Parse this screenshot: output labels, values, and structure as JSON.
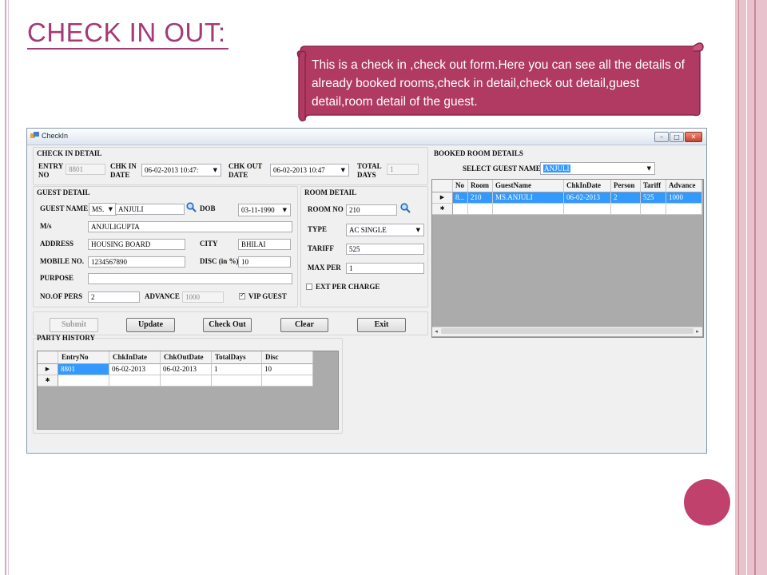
{
  "slide": {
    "title": "CHECK IN OUT",
    "title_colon": ":",
    "callout": "This  is a check in ,check out form.Here you can see all the details of already booked rooms,check in detail,check out detail,guest detail,room detail of the guest.",
    "accent_color": "#a23b77",
    "scroll_color": "#b03a62"
  },
  "window": {
    "title": "CheckIn",
    "controls": {
      "minimize": "–",
      "maximize": "□",
      "close": "✕"
    }
  },
  "checkin": {
    "heading": "CHECK IN DETAIL",
    "entry_no_label": "ENTRY NO",
    "entry_no_value": "8801",
    "chk_in_date_label": "CHK IN DATE",
    "chk_in_date_value": "06-02-2013 10:47:",
    "chk_out_date_label": "CHK OUT DATE",
    "chk_out_date_value": "06-02-2013 10:47",
    "total_days_label": "TOTAL DAYS",
    "total_days_value": "1"
  },
  "guest": {
    "heading": "GUEST DETAIL",
    "name_label": "GUEST NAME",
    "salutation": "MS.",
    "name_value": "ANJULI",
    "dob_label": "DOB",
    "dob_value": "03-11-1990",
    "ms_label": "M/s",
    "ms_value": "ANJULIGUPTA",
    "address_label": "ADDRESS",
    "address_value": "HOUSING BOARD",
    "city_label": "CITY",
    "city_value": "BHILAI",
    "mobile_label": "MOBILE NO.",
    "mobile_value": "1234567890",
    "disc_label": "DISC (in %)",
    "disc_value": "10",
    "purpose_label": "PURPOSE",
    "purpose_value": "",
    "no_of_pers_label": "NO.OF PERS",
    "no_of_pers_value": "2",
    "advance_label": "ADVANCE",
    "advance_value": "1000",
    "vip_label": "VIP GUEST",
    "vip_checked": true
  },
  "room": {
    "heading": "ROOM DETAIL",
    "room_no_label": "ROOM NO",
    "room_no_value": "210",
    "type_label": "TYPE",
    "type_value": "AC SINGLE",
    "tariff_label": "TARIFF",
    "tariff_value": "525",
    "max_per_label": "MAX PER",
    "max_per_value": "1",
    "ext_per_charge_label": "EXT PER CHARGE",
    "ext_per_checked": false
  },
  "buttons": {
    "submit": "Submit",
    "update": "Update",
    "check_out": "Check Out",
    "clear": "Clear",
    "exit": "Exit"
  },
  "booked": {
    "heading": "BOOKED ROOM DETAILS",
    "select_label": "SELECT GUEST NAME",
    "select_value": "ANJULI",
    "columns": [
      "No",
      "Room",
      "GuestName",
      "ChkInDate",
      "Person",
      "Tariff",
      "Advance"
    ],
    "rows": [
      [
        "8...",
        "210",
        "MS.ANJULI",
        "06-02-2013",
        "2",
        "525",
        "1000"
      ]
    ]
  },
  "party": {
    "heading": "PARTY HISTORY",
    "columns": [
      "EntryNo",
      "ChkInDate",
      "ChkOutDate",
      "TotalDays",
      "Disc"
    ],
    "rows": [
      [
        "8801",
        "06-02-2013",
        "06-02-2013",
        "1",
        "10"
      ]
    ]
  },
  "grid_glyphs": {
    "current_row": "▶",
    "new_row": "✱",
    "scroll_left": "◂",
    "scroll_right": "▸",
    "dropdown": "▼"
  }
}
